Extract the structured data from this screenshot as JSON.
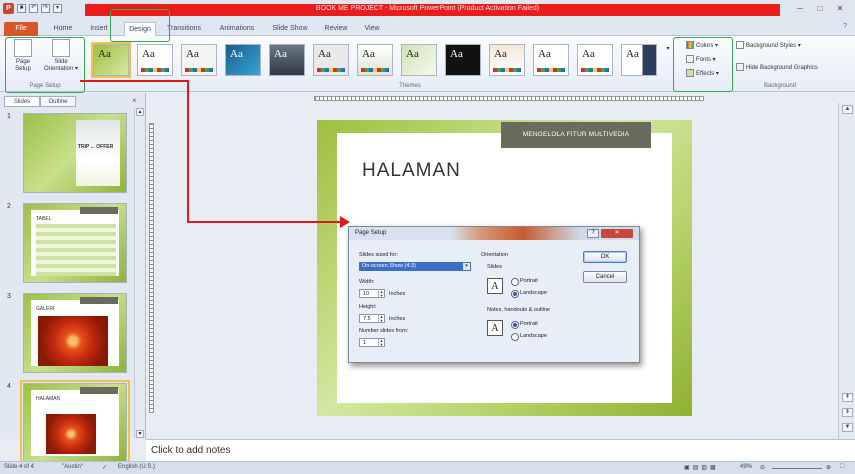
{
  "window": {
    "title": "BOOK ME PROJECT - Microsoft PowerPoint (Product Activation Failed)"
  },
  "qat": {
    "icons": [
      "powerpoint-icon",
      "save-icon",
      "undo-icon",
      "redo-icon",
      "customize-icon"
    ],
    "undo": "↶",
    "redo": "↷"
  },
  "tabs": {
    "file": "File",
    "home": "Home",
    "insert": "Insert",
    "design": "Design",
    "transitions": "Transitions",
    "animations": "Animations",
    "slideshow": "Slide Show",
    "review": "Review",
    "view": "View"
  },
  "ribbon": {
    "page_setup_label": "Page Setup",
    "slide_orientation_label": "Slide Orientation ▾",
    "group_page_setup": "Page Setup",
    "group_themes": "Themes",
    "group_background": "Background",
    "colors": "Colors ▾",
    "fonts": "Fonts ▾",
    "effects": "Effects ▾",
    "background_styles": "Background Styles ▾",
    "hide_background": "Hide Background Graphics",
    "theme_sample": "Aa"
  },
  "left_pane": {
    "tab_slides": "Slides",
    "tab_outline": "Outline",
    "close": "×",
    "slides": [
      {
        "num": "1",
        "title": "TRIP ... OFFER"
      },
      {
        "num": "2",
        "title": "TABEL"
      },
      {
        "num": "3",
        "title": "GALERI"
      },
      {
        "num": "4",
        "title": "HALAMAN"
      }
    ]
  },
  "slide": {
    "tag": "MENGELOLA FITUR MULTIVEDIA",
    "heading": "HALAMAN"
  },
  "dialog": {
    "title": "Page Setup",
    "help": "?",
    "close": "✕",
    "sized_for_label": "Slides sized for:",
    "sized_for_value": "On-screen Show (4:3)",
    "width_label": "Width:",
    "width_value": "10",
    "width_unit": "Inches",
    "height_label": "Height:",
    "height_value": "7.5",
    "height_unit": "Inches",
    "number_from_label": "Number slides from:",
    "number_from_value": "1",
    "orientation_label": "Orientation",
    "slides_label": "Slides",
    "portrait": "Portrait",
    "landscape": "Landscape",
    "notes_label": "Notes, handouts & outline",
    "notes_portrait": "Portrait",
    "notes_landscape": "Landscape",
    "ok": "OK",
    "cancel": "Cancel",
    "slides_orientation_selected": "landscape",
    "notes_orientation_selected": "portrait"
  },
  "notes": {
    "placeholder": "Click to add notes"
  },
  "status": {
    "slide_count": "Slide 4 of 4",
    "theme": "\"Austin\"",
    "language": "English (U.S.)",
    "zoom": "49%"
  },
  "colors": {
    "accent_red": "#ea1c1c",
    "highlight_green": "#34a853",
    "arrow_red": "#e01a1a",
    "slide_green": "#9dbf3f"
  }
}
